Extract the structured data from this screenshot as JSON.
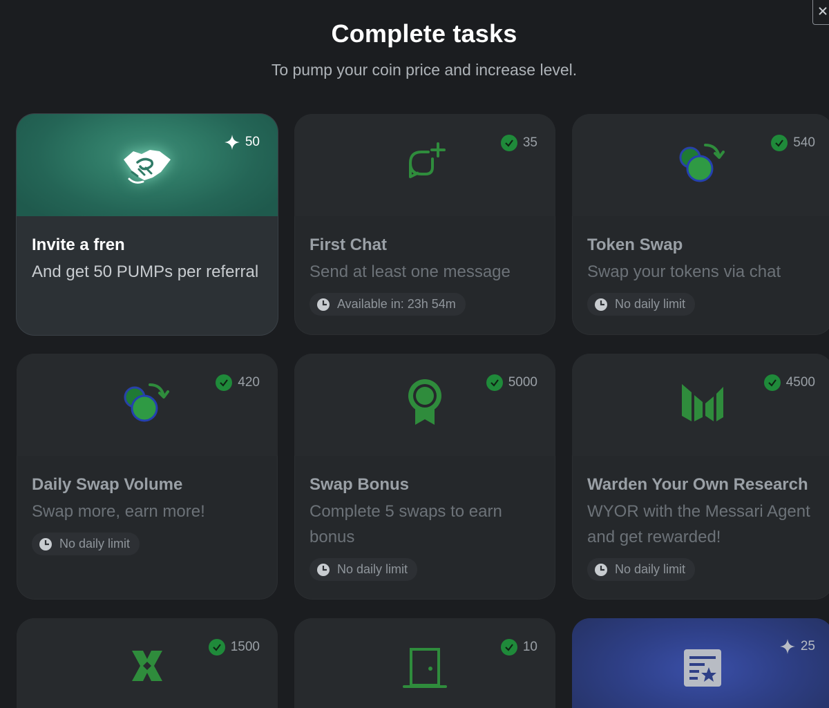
{
  "header": {
    "title": "Complete tasks",
    "subtitle": "To pump your coin price and increase level."
  },
  "colors": {
    "background": "#1b1d20",
    "card": "#25282b",
    "accent_green": "#2fa84f",
    "teal_gradient": "#3f8e78",
    "blue_gradient": "#3a4fa8"
  },
  "tasks": [
    {
      "name": "Invite a fren",
      "description": "And get 50 PUMPs per referral",
      "reward": "50",
      "reward_icon": "sparkle-icon",
      "icon": "handshake-icon",
      "status": ""
    },
    {
      "name": "First Chat",
      "description": "Send at least one message",
      "reward": "35",
      "reward_icon": "check-icon",
      "icon": "chat-plus-icon",
      "status": "Available in: 23h 54m"
    },
    {
      "name": "Token Swap",
      "description": "Swap your tokens via chat",
      "reward": "540",
      "reward_icon": "check-icon",
      "icon": "coin-swap-icon",
      "status": "No daily limit"
    },
    {
      "name": "Daily Swap Volume",
      "description": "Swap more, earn more!",
      "reward": "420",
      "reward_icon": "check-icon",
      "icon": "coin-swap-icon",
      "status": "No daily limit"
    },
    {
      "name": "Swap Bonus",
      "description": "Complete 5 swaps to earn bonus",
      "reward": "5000",
      "reward_icon": "check-icon",
      "icon": "award-ribbon-icon",
      "status": "No daily limit"
    },
    {
      "name": "Warden Your Own Research",
      "description": "WYOR with the Messari Agent and get rewarded!",
      "reward": "4500",
      "reward_icon": "check-icon",
      "icon": "messari-logo-icon",
      "status": "No daily limit"
    },
    {
      "name": "",
      "description": "",
      "reward": "1500",
      "reward_icon": "check-icon",
      "icon": "x-logo-icon",
      "status": ""
    },
    {
      "name": "",
      "description": "",
      "reward": "10",
      "reward_icon": "check-icon",
      "icon": "door-icon",
      "status": ""
    },
    {
      "name": "",
      "description": "",
      "reward": "25",
      "reward_icon": "sparkle-icon",
      "icon": "review-star-icon",
      "status": ""
    }
  ]
}
